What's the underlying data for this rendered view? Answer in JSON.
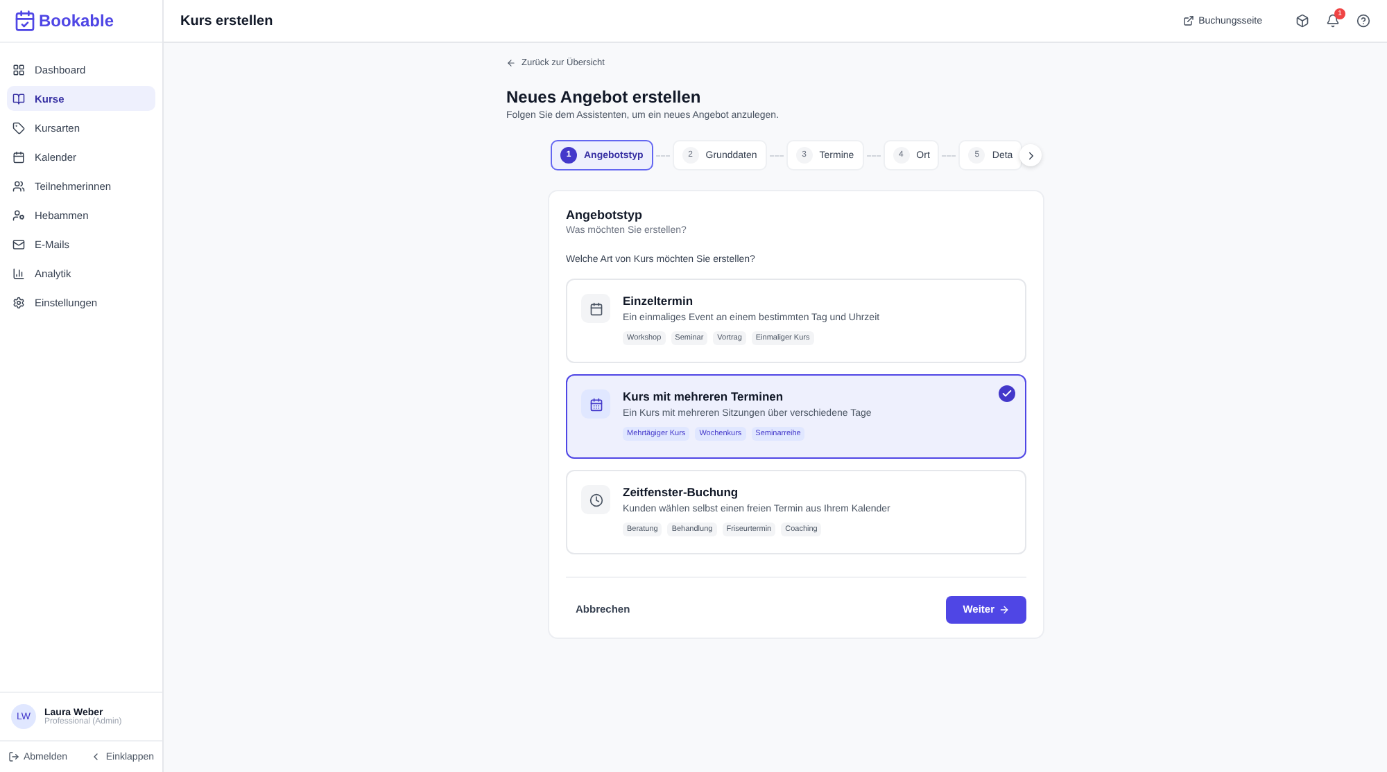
{
  "brand": "Bookable",
  "page_title": "Kurs erstellen",
  "topbar": {
    "booking_link": "Buchungsseite",
    "notification_count": "1"
  },
  "sidebar": {
    "items": [
      {
        "label": "Dashboard",
        "selected": false
      },
      {
        "label": "Kurse",
        "selected": true
      },
      {
        "label": "Kursarten",
        "selected": false
      },
      {
        "label": "Kalender",
        "selected": false
      },
      {
        "label": "Teilnehmerinnen",
        "selected": false
      },
      {
        "label": "Hebammen",
        "selected": false
      },
      {
        "label": "E-Mails",
        "selected": false
      },
      {
        "label": "Analytik",
        "selected": false
      },
      {
        "label": "Einstellungen",
        "selected": false
      }
    ],
    "user": {
      "initials": "LW",
      "name": "Laura Weber",
      "role": "Professional (Admin)"
    },
    "logout": "Abmelden",
    "collapse": "Einklappen"
  },
  "back_link": "Zurück zur Übersicht",
  "heading": "Neues Angebot erstellen",
  "subheading": "Folgen Sie dem Assistenten, um ein neues Angebot anzulegen.",
  "steps": [
    {
      "number": "1",
      "label": "Angebotstyp",
      "selected": true
    },
    {
      "number": "2",
      "label": "Grunddaten",
      "selected": false
    },
    {
      "number": "3",
      "label": "Termine",
      "selected": false
    },
    {
      "number": "4",
      "label": "Ort",
      "selected": false
    },
    {
      "number": "5",
      "label": "Deta",
      "selected": false
    }
  ],
  "card": {
    "title": "Angebotstyp",
    "subtitle": "Was möchten Sie erstellen?",
    "question": "Welche Art von Kurs möchten Sie erstellen?",
    "options": [
      {
        "title": "Einzeltermin",
        "description": "Ein einmaliges Event an einem bestimmten Tag und Uhrzeit",
        "tags": [
          "Workshop",
          "Seminar",
          "Vortrag",
          "Einmaliger Kurs"
        ],
        "selected": false
      },
      {
        "title": "Kurs mit mehreren Terminen",
        "description": "Ein Kurs mit mehreren Sitzungen über verschiedene Tage",
        "tags": [
          "Mehrtägiger Kurs",
          "Wochenkurs",
          "Seminarreihe"
        ],
        "selected": true
      },
      {
        "title": "Zeitfenster-Buchung",
        "description": "Kunden wählen selbst einen freien Termin aus Ihrem Kalender",
        "tags": [
          "Beratung",
          "Behandlung",
          "Friseurtermin",
          "Coaching"
        ],
        "selected": false
      }
    ],
    "cancel": "Abbrechen",
    "next": "Weiter"
  }
}
